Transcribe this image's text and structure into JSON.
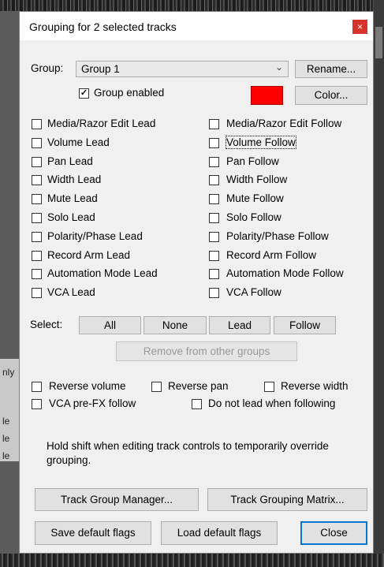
{
  "dialog": {
    "title": "Grouping for 2 selected tracks",
    "close_glyph": "×"
  },
  "group": {
    "label": "Group:",
    "selected": "Group 1",
    "rename_label": "Rename...",
    "enabled_label": "Group enabled",
    "enabled": true,
    "color_label": "Color...",
    "color": "#ff0000"
  },
  "lead_flags": [
    {
      "label": "Media/Razor Edit Lead",
      "checked": false
    },
    {
      "label": "Volume Lead",
      "checked": false
    },
    {
      "label": "Pan Lead",
      "checked": false
    },
    {
      "label": "Width Lead",
      "checked": false
    },
    {
      "label": "Mute Lead",
      "checked": false
    },
    {
      "label": "Solo Lead",
      "checked": false
    },
    {
      "label": "Polarity/Phase Lead",
      "checked": false
    },
    {
      "label": "Record Arm Lead",
      "checked": false
    },
    {
      "label": "Automation Mode Lead",
      "checked": false
    },
    {
      "label": "VCA Lead",
      "checked": false
    }
  ],
  "follow_flags": [
    {
      "label": "Media/Razor Edit Follow",
      "checked": false
    },
    {
      "label": "Volume Follow",
      "checked": false
    },
    {
      "label": "Pan Follow",
      "checked": false
    },
    {
      "label": "Width Follow",
      "checked": false
    },
    {
      "label": "Mute Follow",
      "checked": false
    },
    {
      "label": "Solo Follow",
      "checked": false
    },
    {
      "label": "Polarity/Phase Follow",
      "checked": false
    },
    {
      "label": "Record Arm Follow",
      "checked": false
    },
    {
      "label": "Automation Mode Follow",
      "checked": false
    },
    {
      "label": "VCA Follow",
      "checked": false
    }
  ],
  "select": {
    "label": "Select:",
    "all": "All",
    "none": "None",
    "lead": "Lead",
    "follow": "Follow",
    "remove": "Remove from other groups"
  },
  "options": {
    "reverse_volume": "Reverse volume",
    "reverse_pan": "Reverse pan",
    "reverse_width": "Reverse width",
    "vca_prefx": "VCA pre-FX follow",
    "no_lead_following": "Do not lead when following"
  },
  "note": "Hold shift when editing track controls to temporarily override grouping.",
  "buttons": {
    "manager": "Track Group Manager...",
    "matrix": "Track Grouping Matrix...",
    "save_defaults": "Save default flags",
    "load_defaults": "Load default flags",
    "close": "Close"
  },
  "background": {
    "left_fragments": [
      "nly",
      "le",
      "le",
      "le"
    ]
  }
}
